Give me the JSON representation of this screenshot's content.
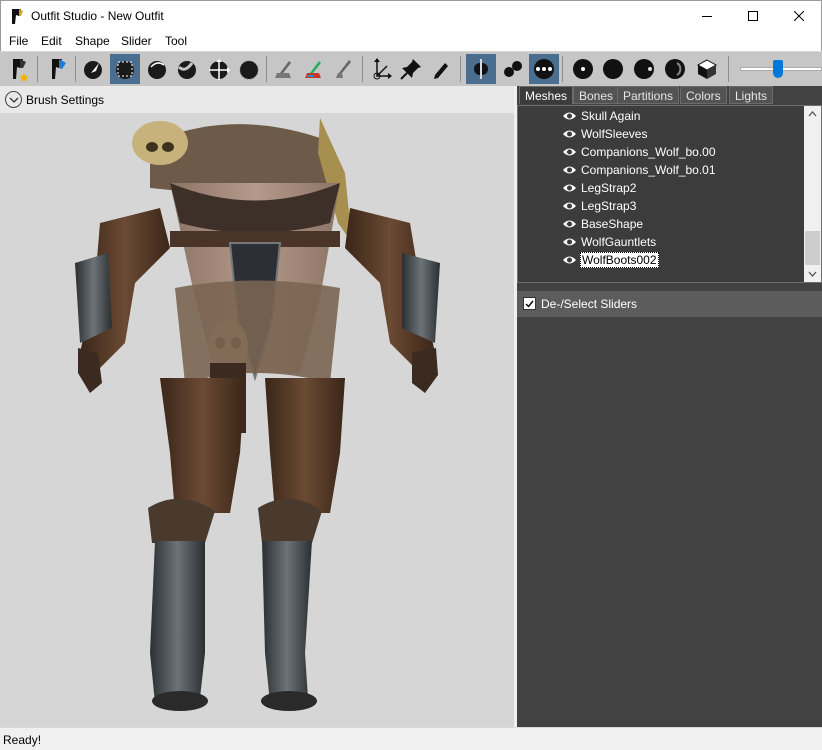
{
  "window": {
    "title": "Outfit Studio - New Outfit",
    "controls": [
      "minimize-icon",
      "maximize-icon",
      "close-icon"
    ]
  },
  "menu": [
    "File",
    "Edit",
    "Shape",
    "Slider",
    "Tool"
  ],
  "toolbar": {
    "tools": [
      {
        "icon": "load-reference-icon",
        "active": false
      },
      {
        "icon": "load-outfit-icon",
        "active": false
      },
      {
        "icon": "select-brush-icon",
        "active": false
      },
      {
        "icon": "mask-brush-icon",
        "active": true
      },
      {
        "icon": "inflate-brush-icon",
        "active": false
      },
      {
        "icon": "deflate-brush-icon",
        "active": false
      },
      {
        "icon": "move-brush-icon",
        "active": false
      },
      {
        "icon": "smooth-brush-icon",
        "active": false
      },
      {
        "icon": "undiff-brush-icon",
        "active": false
      },
      {
        "icon": "weight-brush-icon",
        "active": false
      },
      {
        "icon": "color-brush-icon",
        "active": false
      },
      {
        "icon": "transform-icon",
        "active": false
      },
      {
        "icon": "pivot-icon",
        "active": false
      },
      {
        "icon": "vertex-edit-icon",
        "active": false
      },
      {
        "icon": "x-mirror-icon",
        "active": true
      },
      {
        "icon": "connected-only-icon",
        "active": false
      },
      {
        "icon": "global-brush-icon",
        "active": true
      },
      {
        "icon": "vertex-points-icon",
        "active": false
      },
      {
        "icon": "wireframe-icon",
        "active": false
      },
      {
        "icon": "lighting-icon",
        "active": false
      },
      {
        "icon": "textures-icon",
        "active": false
      },
      {
        "icon": "show-mask-icon",
        "active": false
      }
    ],
    "zoom_level": 0.45
  },
  "brush_settings": {
    "label": "Brush Settings",
    "expanded": false
  },
  "viewport": {
    "background": "#d6d6d6",
    "model": "armored-outfit-model"
  },
  "tabs": [
    {
      "label": "Meshes",
      "active": true
    },
    {
      "label": "Bones",
      "active": false
    },
    {
      "label": "Partitions",
      "active": false
    },
    {
      "label": "Colors",
      "active": false
    },
    {
      "label": "Lights",
      "active": false
    }
  ],
  "meshes": [
    {
      "name": "Skull Again",
      "visible": true,
      "selected": false
    },
    {
      "name": "WolfSleeves",
      "visible": true,
      "selected": false
    },
    {
      "name": "Companions_Wolf_bo.00",
      "visible": true,
      "selected": false
    },
    {
      "name": "Companions_Wolf_bo.01",
      "visible": true,
      "selected": false
    },
    {
      "name": "LegStrap2",
      "visible": true,
      "selected": false
    },
    {
      "name": "LegStrap3",
      "visible": true,
      "selected": false
    },
    {
      "name": "BaseShape",
      "visible": true,
      "selected": false
    },
    {
      "name": "WolfGauntlets",
      "visible": true,
      "selected": false
    },
    {
      "name": "WolfBoots002",
      "visible": true,
      "selected": true
    }
  ],
  "sliders": {
    "label": "De-/Select Sliders",
    "checked": true
  },
  "status": "Ready!",
  "colors": {
    "accent": "#0078d7",
    "active_tool": "#4a6e8f",
    "panel": "#424242"
  }
}
